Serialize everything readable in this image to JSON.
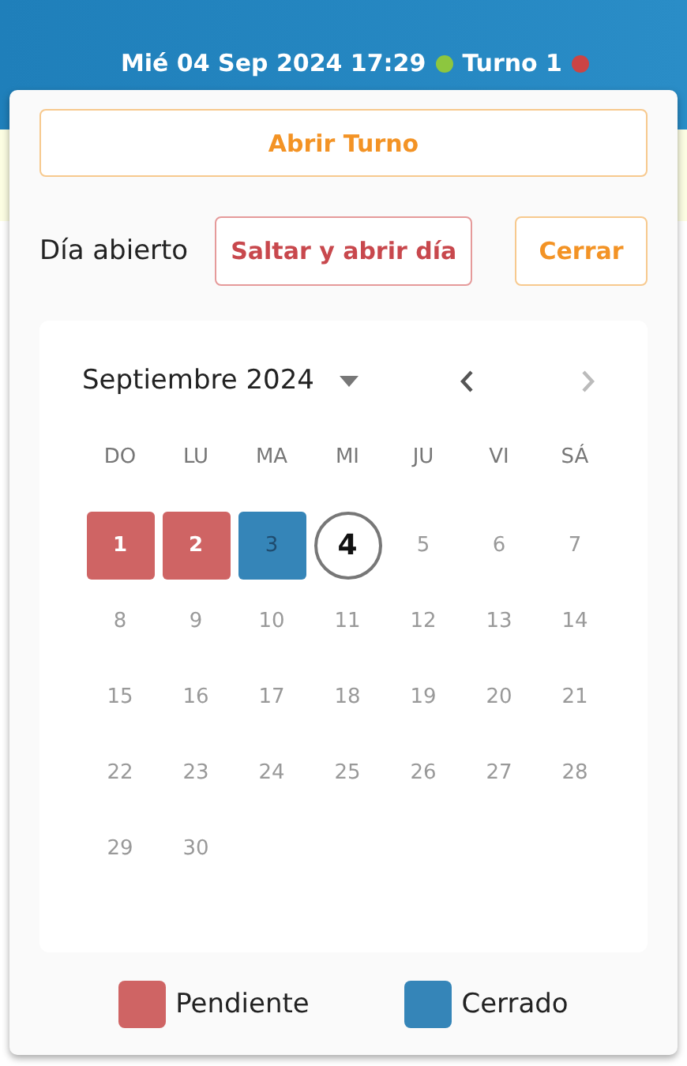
{
  "header": {
    "indicators": [
      {
        "label": "Mié 04 Sep 2024 17:29",
        "color": "#8dc63f"
      },
      {
        "label": "Turno 1",
        "color": "#cc4444"
      }
    ]
  },
  "panel": {
    "open_shift_button": "Abrir Turno",
    "day_status": "Día abierto",
    "skip_button": "Saltar y abrir día",
    "close_button": "Cerrar",
    "calendar": {
      "month": "Septiembre 2024",
      "prev_enabled": true,
      "next_enabled": false,
      "weekdays": [
        "DO",
        "LU",
        "MA",
        "MI",
        "JU",
        "VI",
        "SÁ"
      ],
      "days": [
        {
          "label": "1",
          "kind": "pending"
        },
        {
          "label": "2",
          "kind": "pending"
        },
        {
          "label": "3",
          "kind": "closed"
        },
        {
          "label": "4",
          "kind": "today"
        },
        {
          "label": "5",
          "kind": "normal"
        },
        {
          "label": "6",
          "kind": "normal"
        },
        {
          "label": "7",
          "kind": "normal"
        },
        {
          "label": "8",
          "kind": "normal"
        },
        {
          "label": "9",
          "kind": "normal"
        },
        {
          "label": "10",
          "kind": "normal"
        },
        {
          "label": "11",
          "kind": "normal"
        },
        {
          "label": "12",
          "kind": "normal"
        },
        {
          "label": "13",
          "kind": "normal"
        },
        {
          "label": "14",
          "kind": "normal"
        },
        {
          "label": "15",
          "kind": "normal"
        },
        {
          "label": "16",
          "kind": "normal"
        },
        {
          "label": "17",
          "kind": "normal"
        },
        {
          "label": "18",
          "kind": "normal"
        },
        {
          "label": "19",
          "kind": "normal"
        },
        {
          "label": "20",
          "kind": "normal"
        },
        {
          "label": "21",
          "kind": "normal"
        },
        {
          "label": "22",
          "kind": "normal"
        },
        {
          "label": "23",
          "kind": "normal"
        },
        {
          "label": "24",
          "kind": "normal"
        },
        {
          "label": "25",
          "kind": "normal"
        },
        {
          "label": "26",
          "kind": "normal"
        },
        {
          "label": "27",
          "kind": "normal"
        },
        {
          "label": "28",
          "kind": "normal"
        },
        {
          "label": "29",
          "kind": "normal"
        },
        {
          "label": "30",
          "kind": "normal"
        }
      ]
    },
    "legend": [
      {
        "label": "Pendiente",
        "color": "#cf6464"
      },
      {
        "label": "Cerrado",
        "color": "#3585b8"
      }
    ]
  }
}
